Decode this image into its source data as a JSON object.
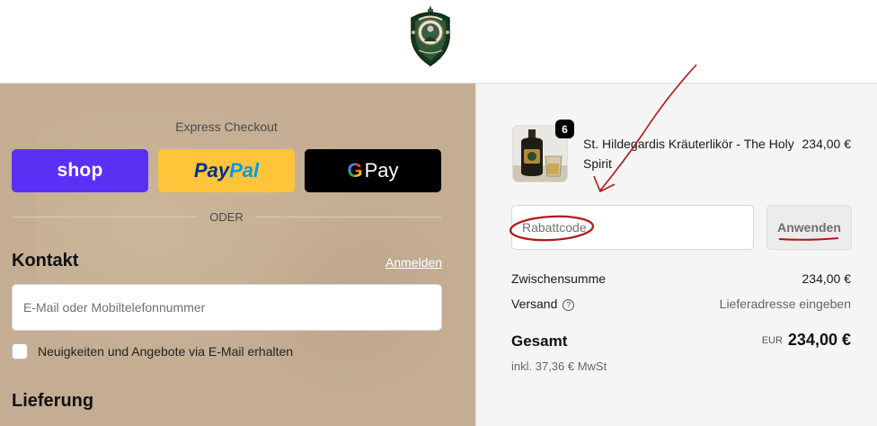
{
  "header": {
    "logo": "st-hildegard-crest-logo"
  },
  "express_checkout": {
    "title": "Express Checkout",
    "shop_label": "shop",
    "paypal_label_1": "Pay",
    "paypal_label_2": "Pal",
    "gpay_g": "G",
    "gpay_label": "Pay",
    "divider_label": "ODER"
  },
  "contact": {
    "title": "Kontakt",
    "login_link": "Anmelden",
    "email_placeholder": "E-Mail oder Mobiltelefonnummer",
    "newsletter_label": "Neuigkeiten und Angebote via E-Mail erhalten",
    "newsletter_checked": false
  },
  "delivery": {
    "title": "Lieferung"
  },
  "order_summary": {
    "product": {
      "name": "St. Hildegardis Kräuterlikör - The Holy Spirit",
      "price": "234,00 €",
      "quantity": "6"
    },
    "discount_placeholder": "Rabattcode",
    "apply_label": "Anwenden",
    "subtotal_label": "Zwischensumme",
    "subtotal_value": "234,00 €",
    "shipping_label": "Versand",
    "shipping_help_icon": "question-circle-icon",
    "shipping_value": "Lieferadresse eingeben",
    "total_label": "Gesamt",
    "total_currency": "EUR",
    "total_value": "234,00 €",
    "tax_note": "inkl. 37,36 € MwSt"
  },
  "colors": {
    "left_panel_bg": "#c4ad92",
    "right_panel_bg": "#f5f5f5",
    "shop_pay": "#5a31f4",
    "paypal": "#ffc439",
    "gpay": "#000000",
    "annotation_red": "#b01818"
  }
}
